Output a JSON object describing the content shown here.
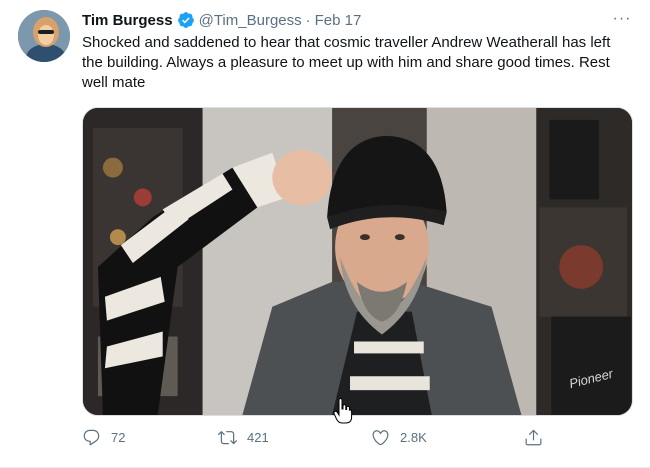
{
  "tweet": {
    "author_name": "Tim Burgess",
    "handle": "@Tim_Burgess",
    "separator": "·",
    "date": "Feb 17",
    "more_label": "···",
    "text": "Shocked and saddened to hear that cosmic traveller Andrew Weatherall has left the building. Always a pleasure to meet up with him and share good times. Rest well mate",
    "media_logo_text": "Pioneer"
  },
  "actions": {
    "reply_count": "72",
    "retweet_count": "421",
    "like_count": "2.8K"
  },
  "icons": {
    "verified": "verified-badge-icon",
    "more": "more-options-icon",
    "reply": "reply-icon",
    "retweet": "retweet-icon",
    "like": "heart-icon",
    "share": "share-icon",
    "cursor": "hand-cursor-icon"
  },
  "colors": {
    "verified_blue": "#1da1f2",
    "secondary_text": "#5b7083",
    "primary_text": "#0f1419"
  }
}
